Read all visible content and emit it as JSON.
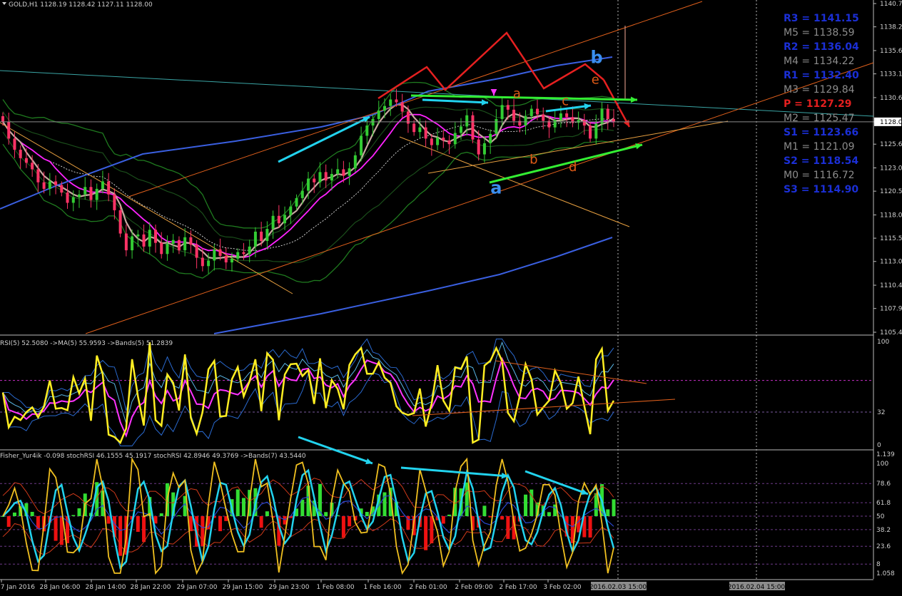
{
  "chart_data": {
    "type": "candlestick",
    "symbol_header": "GOLD,H1  1128.19 1128.42 1127.11 1128.00",
    "current_price": "1128.00",
    "main_y_ticks": [
      "1140.70",
      "1138.20",
      "1135.65",
      "1133.15",
      "1130.60",
      "1128.00",
      "1125.60",
      "1123.05",
      "1120.55",
      "1118.00",
      "1115.50",
      "1113.00",
      "1110.45",
      "1107.95",
      "1105.40"
    ],
    "y_min": 1105.4,
    "y_max": 1140.7,
    "pivots": [
      {
        "label": "R3 = 1141.15",
        "color": "#1b2fd6",
        "bold": true
      },
      {
        "label": "M5 = 1138.59",
        "color": "#8c8c8c",
        "bold": false
      },
      {
        "label": "R2 = 1136.04",
        "color": "#1b2fd6",
        "bold": true
      },
      {
        "label": "M4 = 1134.22",
        "color": "#8c8c8c",
        "bold": false
      },
      {
        "label": "R1 = 1132.40",
        "color": "#1b2fd6",
        "bold": true
      },
      {
        "label": "M3 = 1129.84",
        "color": "#8c8c8c",
        "bold": false
      },
      {
        "label": "P   = 1127.29",
        "color": "#e41f1f",
        "bold": true
      },
      {
        "label": "M2 = 1125.47",
        "color": "#8c8c8c",
        "bold": false
      },
      {
        "label": "S1 = 1123.66",
        "color": "#1b2fd6",
        "bold": true
      },
      {
        "label": "M1 = 1121.09",
        "color": "#8c8c8c",
        "bold": false
      },
      {
        "label": "S2 = 1118.54",
        "color": "#1b2fd6",
        "bold": true
      },
      {
        "label": "M0 = 1116.72",
        "color": "#8c8c8c",
        "bold": false
      },
      {
        "label": "S3 = 1114.90",
        "color": "#1b2fd6",
        "bold": true
      }
    ],
    "wave_labels": [
      {
        "text": "a",
        "color": "#3a8ef0",
        "size": "large",
        "price": 1120.3,
        "bar": 0.56
      },
      {
        "text": "b",
        "color": "#3a8ef0",
        "size": "large",
        "price": 1134.3,
        "bar": 0.675
      },
      {
        "text": "a",
        "color": "#e05a16",
        "size": "small",
        "price": 1130.6,
        "bar": 0.586
      },
      {
        "text": "b",
        "color": "#e05a16",
        "size": "small",
        "price": 1123.5,
        "bar": 0.605
      },
      {
        "text": "c",
        "color": "#e05a16",
        "size": "small",
        "price": 1129.8,
        "bar": 0.642
      },
      {
        "text": "d",
        "color": "#e05a16",
        "size": "small",
        "price": 1122.7,
        "bar": 0.65
      },
      {
        "text": "e",
        "color": "#e05a16",
        "size": "small",
        "price": 1132.1,
        "bar": 0.676
      }
    ],
    "rsi_header": "RSI(5) 52.5080  ->MA(5) 55.9593  ->Bands(5) 51.2839",
    "rsi_y_ticks": [
      "100",
      "32",
      "0"
    ],
    "lower_header": "Fisher_Yur4ik -0.098  stochRSI 46.1555 45.1917  stochRSI 42.8946 49.3769  ->Bands(7) 43.5440",
    "lower_y_ticks": [
      "100",
      "78.6",
      "61.8",
      "50",
      "38.2",
      "23.6",
      "8",
      "1.058"
    ],
    "lower_top_tick": "1.139",
    "x_ticks": [
      "27 Jan 2016",
      "28 Jan 06:00",
      "28 Jan 14:00",
      "28 Jan 22:00",
      "29 Jan 07:00",
      "29 Jan 15:00",
      "29 Jan 23:00",
      "1 Feb 08:00",
      "1 Feb 16:00",
      "2 Feb 01:00",
      "2 Feb 09:00",
      "2 Feb 17:00",
      "3 Feb 02:00"
    ],
    "x_tick_highlight_1": "2016.02.03 15:00",
    "x_tick_highlight_2": "2016.02.04 15:00",
    "close_series": [
      1128.0,
      1126.2,
      1125.0,
      1124.1,
      1123.6,
      1122.9,
      1121.5,
      1120.8,
      1121.6,
      1121.2,
      1120.4,
      1119.3,
      1119.9,
      1120.2,
      1121.0,
      1119.6,
      1120.8,
      1121.6,
      1120.2,
      1118.5,
      1116.0,
      1114.2,
      1115.7,
      1115.9,
      1114.6,
      1116.4,
      1115.0,
      1113.8,
      1114.9,
      1115.3,
      1114.2,
      1115.6,
      1114.8,
      1113.4,
      1112.5,
      1113.1,
      1114.3,
      1113.6,
      1112.9,
      1113.3,
      1114.0,
      1113.8,
      1114.6,
      1116.2,
      1115.2,
      1116.5,
      1117.9,
      1117.1,
      1118.0,
      1118.9,
      1119.8,
      1120.6,
      1121.9,
      1121.5,
      1122.6,
      1121.7,
      1122.4,
      1122.9,
      1122.2,
      1123.0,
      1124.4,
      1126.5,
      1127.6,
      1128.3,
      1129.2,
      1129.7,
      1130.4,
      1130.1,
      1129.1,
      1127.8,
      1126.9,
      1127.4,
      1126.2,
      1125.5,
      1126.3,
      1126.0,
      1125.6,
      1126.8,
      1127.5,
      1128.7,
      1126.1,
      1124.5,
      1125.7,
      1126.7,
      1128.3,
      1129.8,
      1129.3,
      1128.1,
      1127.6,
      1128.6,
      1129.4,
      1128.8,
      1128.1,
      1127.4,
      1128.2,
      1128.9,
      1128.5,
      1127.9,
      1128.2,
      1127.6,
      1126.2,
      1127.8,
      1129.4,
      1128.3,
      1128.0
    ]
  }
}
